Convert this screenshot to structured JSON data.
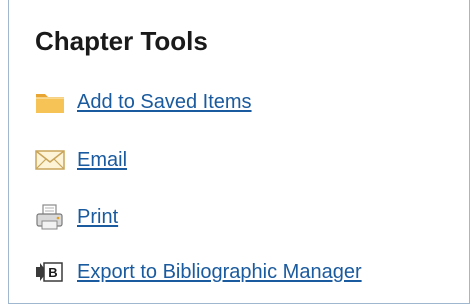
{
  "panel": {
    "title": "Chapter Tools",
    "items": [
      {
        "label": "Add to Saved Items",
        "icon": "folder-icon"
      },
      {
        "label": "Email",
        "icon": "envelope-icon"
      },
      {
        "label": "Print",
        "icon": "printer-icon"
      },
      {
        "label": "Export to Bibliographic Manager",
        "icon": "export-bib-icon"
      }
    ]
  },
  "colors": {
    "link": "#1a5a9e",
    "border": "#9fb7cf",
    "folder": "#f0b43c",
    "title": "#1a1a1a"
  }
}
